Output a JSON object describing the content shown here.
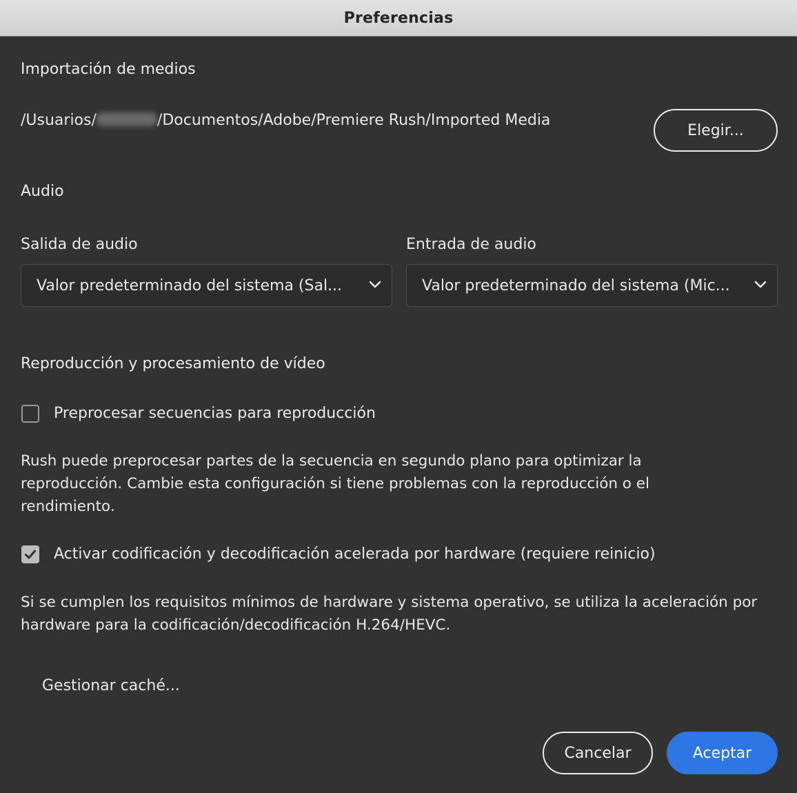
{
  "window": {
    "title": "Preferencias"
  },
  "media_import": {
    "heading": "Importación de medios",
    "path_prefix": "/Usuarios/",
    "path_suffix": "/Documentos/Adobe/Premiere Rush/Imported Media",
    "choose_label": "Elegir..."
  },
  "audio": {
    "heading": "Audio",
    "output_label": "Salida de audio",
    "output_value": "Valor predeterminado del sistema (Sal...",
    "input_label": "Entrada de audio",
    "input_value": "Valor predeterminado del sistema (Mic..."
  },
  "video": {
    "heading": "Reproducción y procesamiento de vídeo",
    "preprocess_label": "Preprocesar secuencias para reproducción",
    "preprocess_checked": false,
    "preprocess_desc": "Rush puede preprocesar partes de la secuencia en segundo plano para optimizar la reproducción. Cambie esta configuración si tiene problemas con la reproducción o el rendimiento.",
    "hw_label": "Activar codificación y decodificación acelerada por hardware (requiere reinicio)",
    "hw_checked": true,
    "hw_desc": "Si se cumplen los requisitos mínimos de hardware y sistema operativo, se utiliza la aceleración por hardware para la codificación/decodificación H.264/HEVC."
  },
  "cache": {
    "manage_label": "Gestionar caché..."
  },
  "footer": {
    "cancel_label": "Cancelar",
    "accept_label": "Aceptar"
  },
  "colors": {
    "background": "#323232",
    "accent": "#2e76e3",
    "titlebar": "#d8d8d8"
  }
}
